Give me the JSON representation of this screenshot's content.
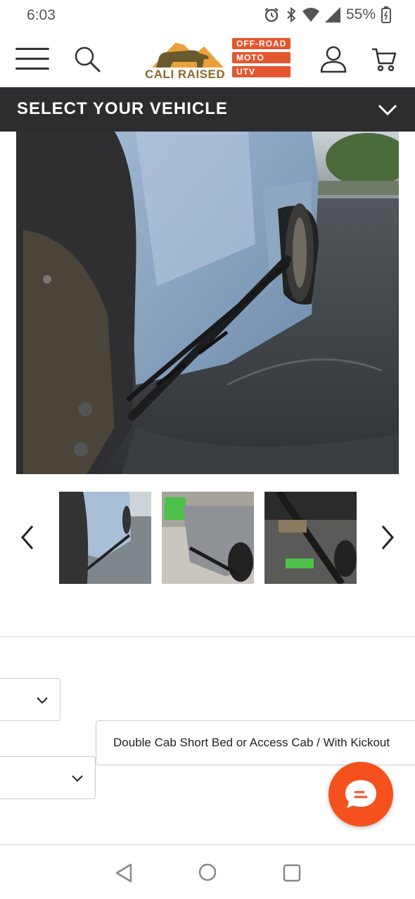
{
  "status": {
    "time": "6:03",
    "battery": "55%",
    "icons": [
      "alarm-icon",
      "bluetooth-icon",
      "wifi-icon",
      "signal-icon",
      "battery-icon"
    ]
  },
  "header": {
    "logo": {
      "brand": "CALI RAISED",
      "tags": [
        "OFF-ROAD",
        "MOTO",
        "UTV"
      ]
    },
    "icons": [
      "menu-icon",
      "search-icon",
      "account-icon",
      "cart-icon"
    ]
  },
  "vehicle_bar": {
    "label": "SELECT YOUR VEHICLE"
  },
  "gallery": {
    "thumbnail_count": 3
  },
  "options": {
    "selected_option": "Double Cab Short Bed or Access Cab / With Kickout"
  },
  "colors": {
    "accent": "#f4511e",
    "bar": "#2d2d2f",
    "logo_tag": "#e4572e"
  }
}
